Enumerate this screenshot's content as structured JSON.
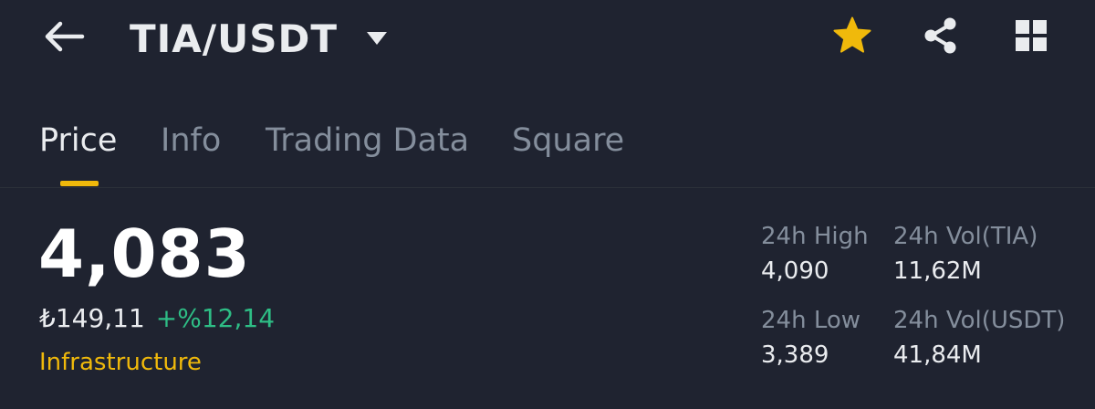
{
  "header": {
    "pair": "TIA/USDT",
    "back_icon": "arrow-left-icon",
    "dropdown_icon": "caret-down-icon",
    "favorite_icon": "star-icon",
    "share_icon": "share-icon",
    "layout_icon": "grid-icon",
    "favorited": true
  },
  "tabs": [
    {
      "label": "Price",
      "active": true
    },
    {
      "label": "Info",
      "active": false
    },
    {
      "label": "Trading Data",
      "active": false
    },
    {
      "label": "Square",
      "active": false
    }
  ],
  "price": {
    "last": "4,083",
    "fiat": "₺149,11",
    "change": "+%12,14",
    "category": "Infrastructure"
  },
  "stats": {
    "high_label": "24h High",
    "high_value": "4,090",
    "low_label": "24h Low",
    "low_value": "3,389",
    "vol_base_label": "24h Vol(TIA)",
    "vol_base_value": "11,62M",
    "vol_quote_label": "24h Vol(USDT)",
    "vol_quote_value": "41,84M"
  },
  "colors": {
    "background": "#1f2330",
    "accent": "#f0b90b",
    "positive": "#2ebd85",
    "muted_text": "#848e9c",
    "primary_text": "#eaecef"
  }
}
